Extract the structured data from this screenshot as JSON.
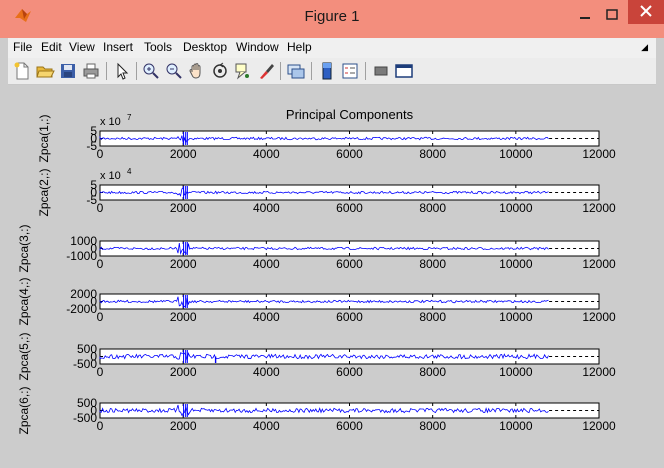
{
  "window": {
    "title": "Figure 1"
  },
  "menu": [
    "File",
    "Edit",
    "View",
    "Insert",
    "Tools",
    "Desktop",
    "Window",
    "Help"
  ],
  "toolbar": {
    "tools": [
      "new-figure-icon",
      "open-file-icon",
      "save-icon",
      "print-icon",
      "edit-plot-icon",
      "zoom-in-icon",
      "zoom-out-icon",
      "pan-icon",
      "rotate-3d-icon",
      "data-cursor-icon",
      "brush-icon",
      "link-plot-icon",
      "insert-colorbar-icon",
      "insert-legend-icon",
      "hide-plot-tools-icon",
      "show-plot-tools-icon"
    ]
  },
  "colors": {
    "titlebar": "#f38e7d",
    "close_button": "#c9443a",
    "trace": "#0000ff",
    "figure_bg": "#cccccc"
  },
  "chart_data": {
    "type": "line",
    "title": "Principal Components",
    "xlim": [
      0,
      12000
    ],
    "x_ticks": [
      "0",
      "2000",
      "4000",
      "6000",
      "8000",
      "10000",
      "12000"
    ],
    "data_x_range": [
      0,
      10800
    ],
    "subplots": [
      {
        "ylabel": "Zpca(1,:)",
        "exponent": "x 10",
        "exponent_power": "7",
        "y_ticks": [
          "5",
          "0",
          "-5"
        ],
        "ylim": [
          -5,
          5
        ],
        "trace_level": 0
      },
      {
        "ylabel": "Zpca(2,:)",
        "exponent": "x 10",
        "exponent_power": "4",
        "y_ticks": [
          "5",
          "0",
          "-5"
        ],
        "ylim": [
          -5,
          5
        ],
        "trace_level": 0
      },
      {
        "ylabel": "Zpca(3,:)",
        "exponent": "",
        "exponent_power": "",
        "y_ticks": [
          "1000",
          "0",
          "-1000"
        ],
        "ylim": [
          -1000,
          1000
        ],
        "trace_level": 0
      },
      {
        "ylabel": "Zpca(4,:)",
        "exponent": "",
        "exponent_power": "",
        "y_ticks": [
          "2000",
          "0",
          "-2000"
        ],
        "ylim": [
          -2000,
          2000
        ],
        "trace_level": 0
      },
      {
        "ylabel": "Zpca(5,:)",
        "exponent": "",
        "exponent_power": "",
        "y_ticks": [
          "500",
          "0",
          "-500"
        ],
        "ylim": [
          -500,
          500
        ],
        "trace_level": 0
      },
      {
        "ylabel": "Zpca(6,:)",
        "exponent": "",
        "exponent_power": "",
        "y_ticks": [
          "500",
          "0",
          "-500"
        ],
        "ylim": [
          -500,
          500
        ],
        "trace_level": 0
      }
    ]
  }
}
